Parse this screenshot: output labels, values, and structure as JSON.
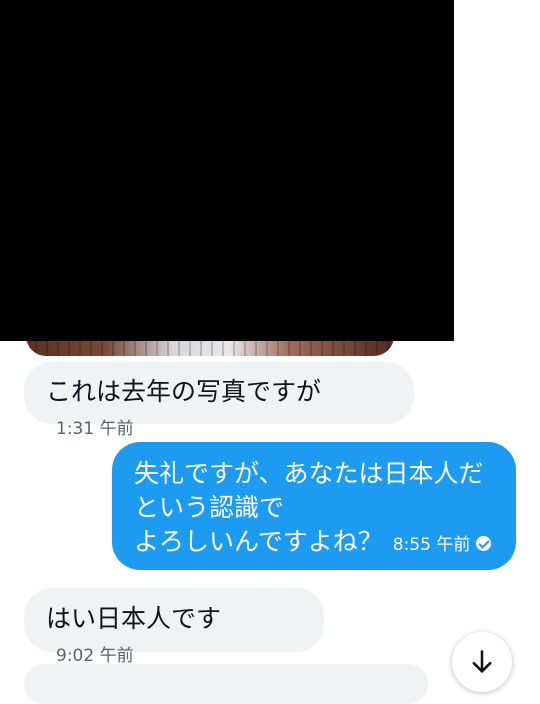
{
  "messages": [
    {
      "direction": "incoming",
      "text": "これは去年の写真ですが",
      "time": "1:31 午前"
    },
    {
      "direction": "outgoing",
      "text": "失礼ですが、あなたは日本人だ\nという認識で\nよろしいんですよね？",
      "time": "8:55 午前",
      "status_icon": "read-check-icon"
    },
    {
      "direction": "incoming",
      "text": "はい日本人です",
      "time": "9:02 午前"
    }
  ],
  "scroll_button_icon": "arrow-down-icon",
  "colors": {
    "outgoing_bubble": "#1d9bf0",
    "incoming_bubble": "#eff3f4",
    "redaction": "#000000"
  }
}
